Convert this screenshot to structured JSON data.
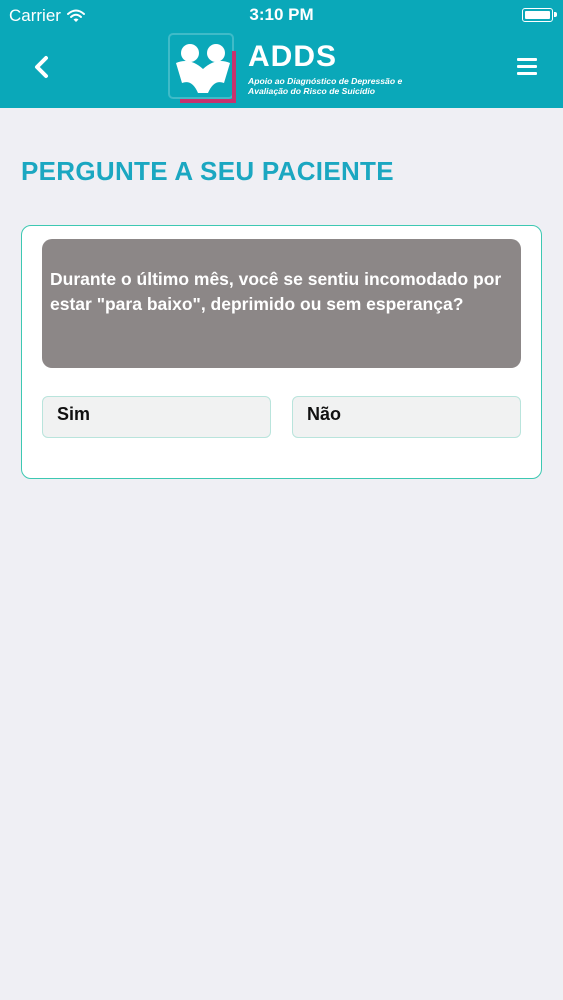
{
  "status_bar": {
    "carrier": "Carrier",
    "time": "3:10 PM"
  },
  "header": {
    "logo_title": "ADDS",
    "logo_subtitle": "Apoio ao Diagnóstico de Depressão e Avaliação do Risco de Suicídio",
    "back_icon": "chevron-left-icon",
    "menu_icon": "hamburger-menu-icon"
  },
  "main": {
    "title": "PERGUNTE A SEU PACIENTE",
    "question": "Durante o último mês, você se sentiu incomodado por estar \"para baixo\", deprimido ou sem esperança?",
    "answers": {
      "yes": "Sim",
      "no": "Não"
    }
  },
  "colors": {
    "header_bg": "#0aa8b9",
    "title": "#1ba7c1",
    "card_border": "#3dc8b2",
    "question_bg": "#8c8787",
    "logo_accent": "#c8326e",
    "page_bg": "#efeff4"
  }
}
